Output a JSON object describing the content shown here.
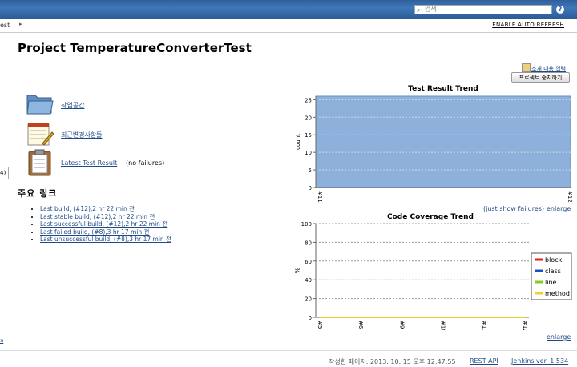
{
  "header": {
    "search_placeholder": "검색",
    "help": "?"
  },
  "breadcrumb": {
    "current": "est"
  },
  "actions": {
    "auto_refresh": "ENABLE AUTO REFRESH"
  },
  "project": {
    "title": "Project TemperatureConverterTest",
    "edit_description": "소개 내용 입력",
    "disable_button": "프로젝트 중지하기"
  },
  "items": {
    "workspace": "작업공간",
    "changes": "최근변경사항들",
    "latest_test_result": "Latest Test Result",
    "no_failures": "(no failures)"
  },
  "permalinks": {
    "title": "주요 링크",
    "links": [
      "Last build, (#12),2 hr 22 min 전",
      "Last stable build, (#12),2 hr 22 min 전",
      "Last successful build, (#12),2 hr 22 min 전",
      "Last failed build, (#8),3 hr 17 min 전",
      "Last unsuccessful build, (#8),3 hr 17 min 전"
    ]
  },
  "sidebar": {
    "tab": "4)",
    "link": "a"
  },
  "test_trend": {
    "just_show_failures": "(just show failures)",
    "enlarge": "enlarge"
  },
  "coverage_trend": {
    "enlarge": "enlarge"
  },
  "footer": {
    "generated": "작성한 페이지: 2013. 10. 15 오후 12:47:55",
    "rest_api": "REST API",
    "version": "Jenkins ver. 1.534"
  },
  "colors": {
    "header": "#3f77b8",
    "test_area": "#8eb1dc",
    "block": "#e02020",
    "class": "#2050c0",
    "line": "#80d020",
    "method": "#f0d020"
  },
  "chart_data": [
    {
      "type": "area",
      "title": "Test Result Trend",
      "ylabel": "count",
      "xlabel": "",
      "categories": [
        "#11",
        "#12"
      ],
      "series": [
        {
          "values": [
            26,
            26
          ]
        }
      ],
      "yticks": [
        0,
        5,
        10,
        15,
        20,
        25
      ],
      "ylim": [
        0,
        26
      ],
      "grid": true
    },
    {
      "type": "line",
      "title": "Code Coverage Trend",
      "ylabel": "%",
      "xlabel": "",
      "categories": [
        "#5",
        "#6",
        "#9",
        "#10",
        "#11",
        "#12"
      ],
      "yticks": [
        0,
        20,
        40,
        60,
        80,
        100
      ],
      "ylim": [
        0,
        100
      ],
      "legend": "right",
      "series": [
        {
          "name": "block",
          "values": [
            0,
            0,
            0,
            0,
            0,
            0
          ]
        },
        {
          "name": "class",
          "values": [
            0,
            0,
            0,
            0,
            0,
            0
          ]
        },
        {
          "name": "line",
          "values": [
            0,
            0,
            0,
            0,
            0,
            0
          ]
        },
        {
          "name": "method",
          "values": [
            0,
            0,
            0,
            0,
            0,
            0
          ]
        }
      ]
    }
  ]
}
